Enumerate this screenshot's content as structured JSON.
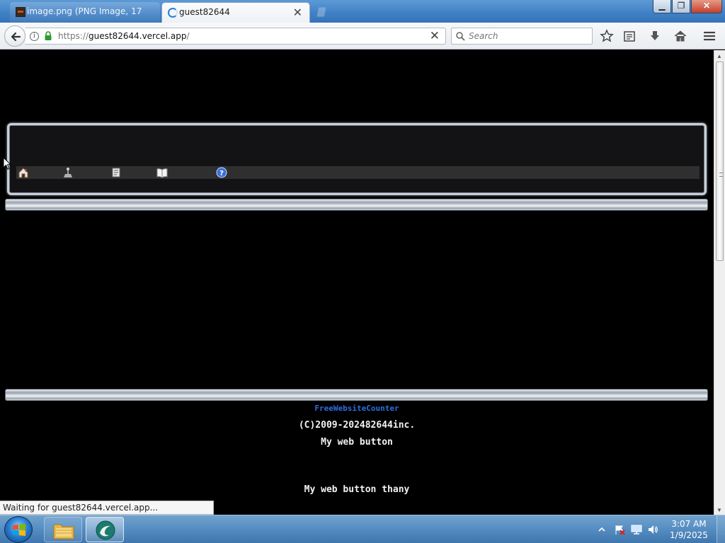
{
  "browser": {
    "tabs": [
      {
        "label": "image.png (PNG Image, 17",
        "active": false
      },
      {
        "label": "guest82644",
        "active": true
      }
    ],
    "window_controls": {
      "minimize": "▁",
      "maximize": "❐",
      "close": "✕"
    },
    "url": {
      "scheme": "https://",
      "host": "guest82644.vercel.app",
      "path": "/"
    },
    "search_placeholder": "Search",
    "toolbar_icons": [
      "star-icon",
      "reading-list-icon",
      "download-icon",
      "home-icon",
      "menu-icon"
    ]
  },
  "page": {
    "background": "#000000",
    "nav_icons": [
      "home-icon",
      "joystick-icon",
      "note-icon",
      "book-icon",
      "help-icon"
    ],
    "footer": {
      "counter_link": "FreeWebsiteCounter",
      "copyright": "(C)2009-202482644inc.",
      "web_button": "My web button",
      "web_button_2": "My web button thany"
    }
  },
  "status_bar": {
    "text": "Waiting for guest82644.vercel.app..."
  },
  "taskbar": {
    "pinned": [
      "windows-explorer-icon",
      "browser-app-icon"
    ],
    "tray": {
      "time": "3:07 AM",
      "date": "1/9/2025"
    }
  },
  "colors": {
    "link": "#2f6de0",
    "text": "#f2f2f2",
    "accent": "#3673b8"
  }
}
